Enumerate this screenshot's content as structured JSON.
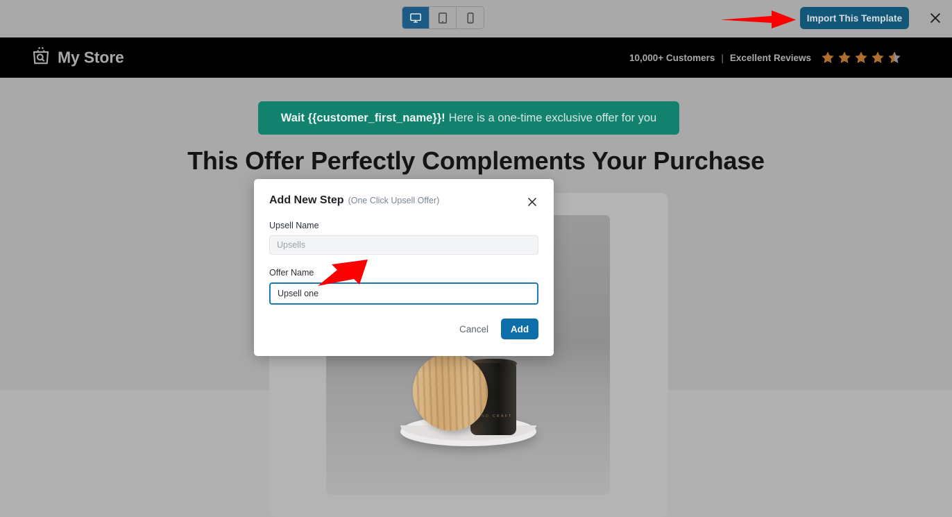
{
  "toolbar": {
    "devices": [
      {
        "name": "desktop",
        "icon": "monitor-icon",
        "active": true
      },
      {
        "name": "tablet",
        "icon": "tablet-icon",
        "active": false
      },
      {
        "name": "mobile",
        "icon": "mobile-icon",
        "active": false
      }
    ],
    "import_label": "Import This Template",
    "close_icon": "close-icon",
    "accent_color": "#125777"
  },
  "store_header": {
    "logo_text": "My Store",
    "logo_icon": "shopping-bag-search-icon",
    "customers_text": "10,000+ Customers",
    "separator": "|",
    "reviews_text": "Excellent Reviews",
    "rating": 4.5,
    "star_count": 5,
    "star_color": "#b06f30",
    "background_color": "#000000"
  },
  "page": {
    "banner": {
      "strong_text": "Wait {{customer_first_name}}!",
      "rest_text": "Here is a one-time exclusive offer for you",
      "background_color": "#12826f"
    },
    "heading": "This Offer Perfectly Complements Your Purchase",
    "product_image_alt": "Dark amber glass jar with wooden lid on marble podium",
    "jar_label_text": "HAND CRAFT"
  },
  "modal": {
    "title": "Add New Step",
    "subtitle": "(One Click Upsell Offer)",
    "close_icon": "close-icon",
    "fields": [
      {
        "label": "Upsell Name",
        "value": "",
        "placeholder": "Upsells",
        "disabled": true
      },
      {
        "label": "Offer Name",
        "value": "Upsell one",
        "placeholder": "",
        "focused": true
      }
    ],
    "cancel_label": "Cancel",
    "add_label": "Add",
    "add_button_color": "#0d6ea9",
    "focus_border_color": "#1a7ab2"
  },
  "annotations": {
    "arrow_color": "#fb0000",
    "arrow_import_target": "Import This Template",
    "arrow_offer_target": "Offer Name input"
  }
}
